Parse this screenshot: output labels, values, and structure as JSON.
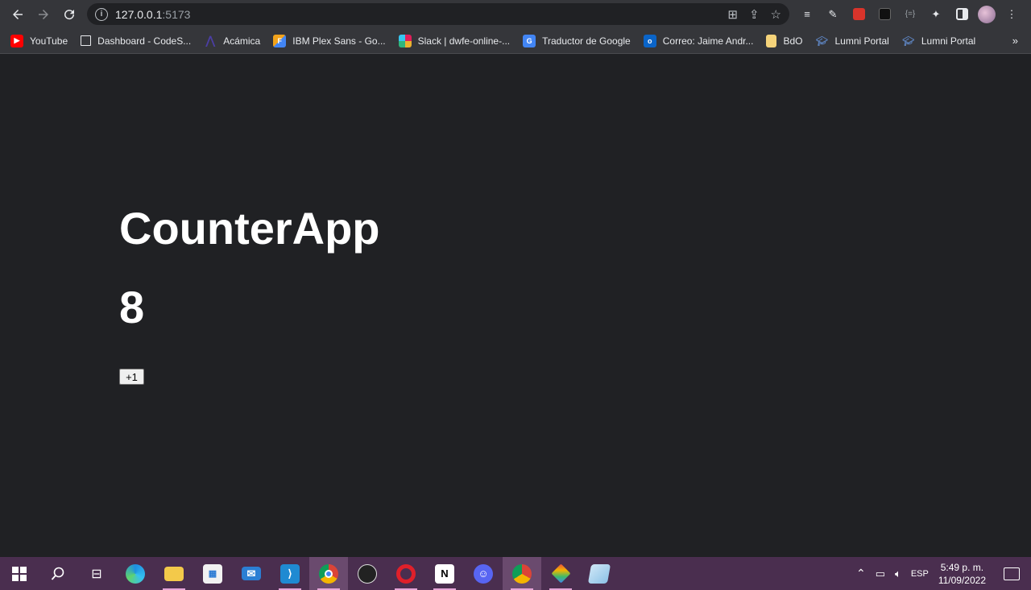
{
  "browser": {
    "url_host": "127.0.0.1",
    "url_port": ":5173",
    "bookmarks": [
      {
        "label": "YouTube",
        "icon": "youtube-icon",
        "color": "#ff0000"
      },
      {
        "label": "Dashboard - CodeS...",
        "icon": "page-icon",
        "color": "#35363a"
      },
      {
        "label": "Acámica",
        "icon": "acamica-icon",
        "color": "#4b3ea3"
      },
      {
        "label": "IBM Plex Sans - Go...",
        "icon": "google-fonts-icon",
        "color": "#f2a31b"
      },
      {
        "label": "Slack | dwfe-online-...",
        "icon": "slack-icon",
        "color": "#e01e5a"
      },
      {
        "label": "Traductor de Google",
        "icon": "google-translate-icon",
        "color": "#4285f4"
      },
      {
        "label": "Correo: Jaime Andr...",
        "icon": "outlook-icon",
        "color": "#0a64c8"
      },
      {
        "label": "BdO",
        "icon": "folder-icon",
        "color": "#f5d37a"
      },
      {
        "label": "Lumni Portal",
        "icon": "lumni-icon",
        "color": "#3b5a8c"
      },
      {
        "label": "Lumni Portal",
        "icon": "lumni-icon",
        "color": "#3b5a8c"
      }
    ]
  },
  "app": {
    "title": "CounterApp",
    "count": "8",
    "increment_label": "+1"
  },
  "taskbar": {
    "language": "ESP",
    "time": "5:49 p. m.",
    "date": "11/09/2022"
  }
}
